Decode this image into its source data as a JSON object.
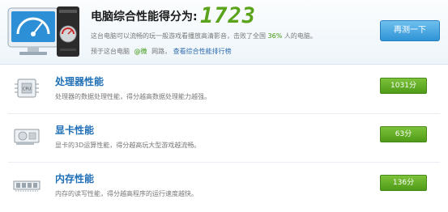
{
  "header": {
    "score_title": "电脑综合性能得分为:",
    "score_value": "1723",
    "desc_prefix": "这台电脑可以流畅的玩一般游戏看播放高清影音，击败了全国",
    "desc_percent": "36%",
    "desc_suffix": "人的电脑。",
    "share_prefix": "预于这台电脑",
    "share_weibo": "@微",
    "share_middle": "网路，",
    "share_rank_link": "查看综合性能排行榜",
    "retest_label": "再测一下"
  },
  "rows": [
    {
      "icon": "cpu-icon",
      "title": "处理器性能",
      "desc": "处理器的数据处理性能，得分越高数据处理能力越强。",
      "score": "1031分"
    },
    {
      "icon": "graphics-card-icon",
      "title": "显卡性能",
      "desc": "显卡的3D运算性能，得分越高玩大型游戏越流畅。",
      "score": "63分"
    },
    {
      "icon": "memory-icon",
      "title": "内存性能",
      "desc": "内存的读写性能，得分越高程序的运行速度越快。",
      "score": "136分"
    }
  ],
  "colors": {
    "accent_green": "#5aa31a",
    "title_blue": "#1f6fb7",
    "button_blue": "#2f93d6"
  }
}
